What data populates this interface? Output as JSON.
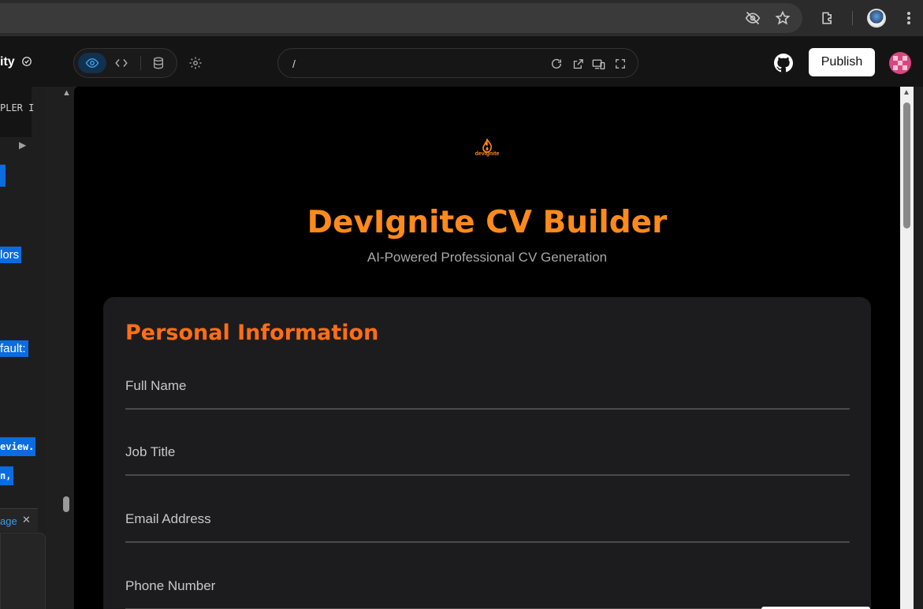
{
  "browser": {
    "icons": [
      "eye-off-icon",
      "star-icon",
      "extensions-icon",
      "profile-icon",
      "more-vert-icon"
    ]
  },
  "app": {
    "title_fragment": "ity",
    "view_modes": [
      "preview",
      "code",
      "database"
    ],
    "url_path": "/",
    "publish_label": "Publish"
  },
  "editor": {
    "code_fragment": "PLER I",
    "highlights": [
      "",
      "lors",
      "fault:",
      "eview.",
      "n,"
    ],
    "bottom_tab_label": "age"
  },
  "preview": {
    "logo_text": "devignite",
    "title": "DevIgnite CV Builder",
    "subtitle": "AI-Powered Professional CV Generation",
    "section_title": "Personal Information",
    "fields": [
      "Full Name",
      "Job Title",
      "Email Address",
      "Phone Number"
    ]
  },
  "colors": {
    "accent_orange": "#ff8a1c",
    "section_orange": "#ff6e14",
    "highlight_blue": "#0b6ce0",
    "active_blue": "#3d9be9"
  }
}
